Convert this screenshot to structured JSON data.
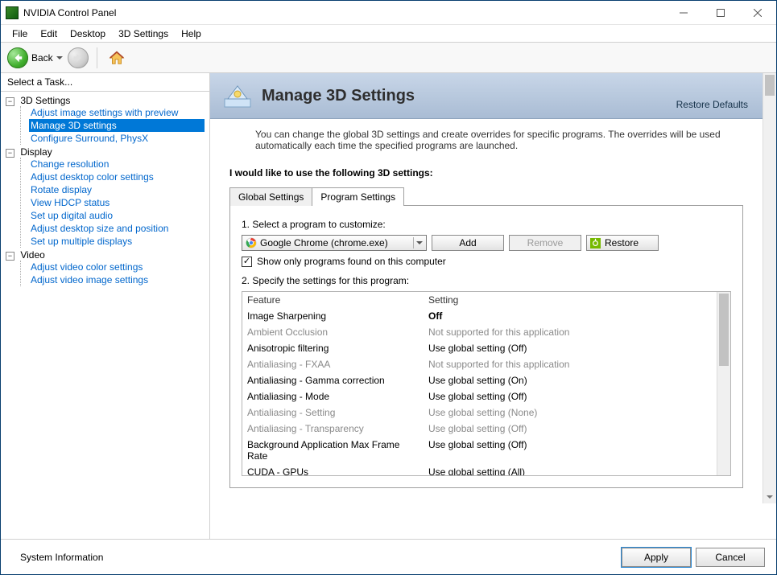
{
  "window": {
    "title": "NVIDIA Control Panel"
  },
  "menubar": [
    "File",
    "Edit",
    "Desktop",
    "3D Settings",
    "Help"
  ],
  "toolbar": {
    "back_label": "Back"
  },
  "sidebar": {
    "heading": "Select a Task...",
    "groups": [
      {
        "label": "3D Settings",
        "items": [
          {
            "label": "Adjust image settings with preview",
            "selected": false
          },
          {
            "label": "Manage 3D settings",
            "selected": true
          },
          {
            "label": "Configure Surround, PhysX",
            "selected": false
          }
        ]
      },
      {
        "label": "Display",
        "items": [
          {
            "label": "Change resolution"
          },
          {
            "label": "Adjust desktop color settings"
          },
          {
            "label": "Rotate display"
          },
          {
            "label": "View HDCP status"
          },
          {
            "label": "Set up digital audio"
          },
          {
            "label": "Adjust desktop size and position"
          },
          {
            "label": "Set up multiple displays"
          }
        ]
      },
      {
        "label": "Video",
        "items": [
          {
            "label": "Adjust video color settings"
          },
          {
            "label": "Adjust video image settings"
          }
        ]
      }
    ]
  },
  "page": {
    "title": "Manage 3D Settings",
    "restore_defaults": "Restore Defaults",
    "description": "You can change the global 3D settings and create overrides for specific programs. The overrides will be used automatically each time the specified programs are launched.",
    "section_label": "I would like to use the following 3D settings:",
    "tabs": [
      "Global Settings",
      "Program Settings"
    ],
    "active_tab_index": 1,
    "step1_label": "1. Select a program to customize:",
    "program_selected": "Google Chrome (chrome.exe)",
    "btn_add": "Add",
    "btn_remove": "Remove",
    "btn_restore": "Restore",
    "show_only_label": "Show only programs found on this computer",
    "show_only_checked": true,
    "step2_label": "2. Specify the settings for this program:",
    "grid_headers": [
      "Feature",
      "Setting"
    ],
    "grid_rows": [
      {
        "feature": "Image Sharpening",
        "setting": "Off",
        "dim": false,
        "bold_setting": true
      },
      {
        "feature": "Ambient Occlusion",
        "setting": "Not supported for this application",
        "dim": true
      },
      {
        "feature": "Anisotropic filtering",
        "setting": "Use global setting (Off)",
        "dim": false
      },
      {
        "feature": "Antialiasing - FXAA",
        "setting": "Not supported for this application",
        "dim": true
      },
      {
        "feature": "Antialiasing - Gamma correction",
        "setting": "Use global setting (On)",
        "dim": false
      },
      {
        "feature": "Antialiasing - Mode",
        "setting": "Use global setting (Off)",
        "dim": false
      },
      {
        "feature": "Antialiasing - Setting",
        "setting": "Use global setting (None)",
        "dim": true
      },
      {
        "feature": "Antialiasing - Transparency",
        "setting": "Use global setting (Off)",
        "dim": true
      },
      {
        "feature": "Background Application Max Frame Rate",
        "setting": "Use global setting (Off)",
        "dim": false
      },
      {
        "feature": "CUDA - GPUs",
        "setting": "Use global setting (All)",
        "dim": false
      }
    ]
  },
  "footer": {
    "system_information": "System Information",
    "apply": "Apply",
    "cancel": "Cancel"
  }
}
